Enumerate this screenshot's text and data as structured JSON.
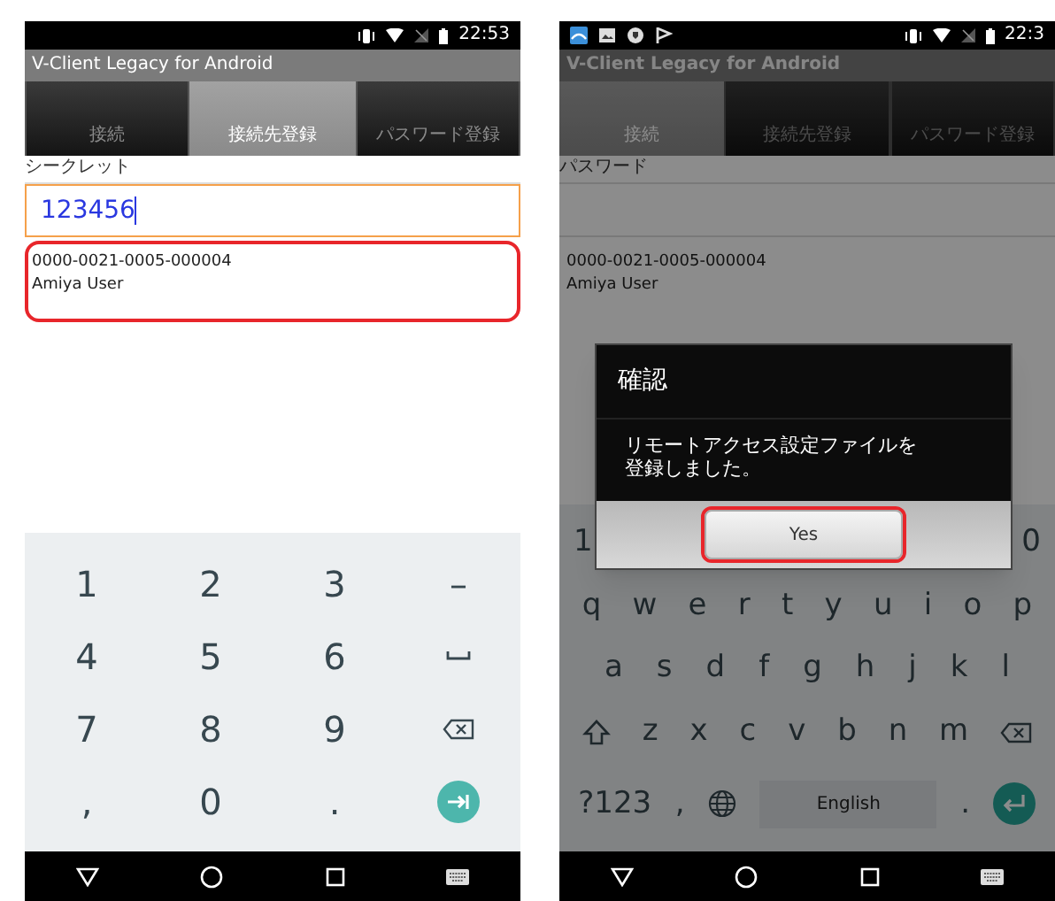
{
  "phones": [
    {
      "status_bar": {
        "has_notifications": false,
        "time": "22:53"
      },
      "app_title": "V-Client Legacy for Android",
      "tabs": [
        {
          "label": "接続",
          "selected": false
        },
        {
          "label": "接続先登録",
          "selected": true
        },
        {
          "label": "パスワード登録",
          "selected": false
        }
      ],
      "field": {
        "label": "シークレット",
        "value": "123456",
        "focused": true
      },
      "entry": {
        "lines": [
          "0000-0021-0005-000004",
          "Amiya User"
        ],
        "highlighted": true
      },
      "keyboard": {
        "kind": "numeric",
        "rows": [
          {
            "keys": [
              {
                "kind": "char",
                "label": "1"
              },
              {
                "kind": "char",
                "label": "2"
              },
              {
                "kind": "char",
                "label": "3"
              },
              {
                "kind": "char",
                "label": "–"
              }
            ]
          },
          {
            "keys": [
              {
                "kind": "char",
                "label": "4"
              },
              {
                "kind": "char",
                "label": "5"
              },
              {
                "kind": "char",
                "label": "6"
              },
              {
                "kind": "space"
              }
            ]
          },
          {
            "keys": [
              {
                "kind": "char",
                "label": "7"
              },
              {
                "kind": "char",
                "label": "8"
              },
              {
                "kind": "char",
                "label": "9"
              },
              {
                "kind": "backspace"
              }
            ]
          },
          {
            "keys": [
              {
                "kind": "char",
                "label": ","
              },
              {
                "kind": "char",
                "label": "0"
              },
              {
                "kind": "char",
                "label": "."
              },
              {
                "kind": "next"
              }
            ]
          }
        ]
      }
    },
    {
      "status_bar": {
        "has_notifications": true,
        "time": "22:3"
      },
      "app_title": "V-Client Legacy for Android",
      "tabs": [
        {
          "label": "接続",
          "selected": true
        },
        {
          "label": "接続先登録",
          "selected": false
        },
        {
          "label": "パスワード登録",
          "selected": false
        }
      ],
      "field": {
        "label": "パスワード",
        "focused": false
      },
      "entry": {
        "lines": [
          "0000-0021-0005-000004",
          "Amiya User"
        ],
        "highlighted": false
      },
      "keyboard": {
        "kind": "qwerty",
        "rows": [
          {
            "keys": [
              {
                "kind": "char",
                "label": "1"
              },
              {
                "kind": "char",
                "label": "0"
              }
            ]
          },
          {
            "keys": [
              {
                "kind": "char",
                "label": "q"
              },
              {
                "kind": "char",
                "label": "w"
              },
              {
                "kind": "char",
                "label": "e"
              },
              {
                "kind": "char",
                "label": "r"
              },
              {
                "kind": "char",
                "label": "t"
              },
              {
                "kind": "char",
                "label": "y"
              },
              {
                "kind": "char",
                "label": "u"
              },
              {
                "kind": "char",
                "label": "i"
              },
              {
                "kind": "char",
                "label": "o"
              },
              {
                "kind": "char",
                "label": "p"
              }
            ]
          },
          {
            "keys": [
              {
                "kind": "char",
                "label": "a"
              },
              {
                "kind": "char",
                "label": "s"
              },
              {
                "kind": "char",
                "label": "d"
              },
              {
                "kind": "char",
                "label": "f"
              },
              {
                "kind": "char",
                "label": "g"
              },
              {
                "kind": "char",
                "label": "h"
              },
              {
                "kind": "char",
                "label": "j"
              },
              {
                "kind": "char",
                "label": "k"
              },
              {
                "kind": "char",
                "label": "l"
              }
            ]
          },
          {
            "keys": [
              {
                "kind": "shift"
              },
              {
                "kind": "char",
                "label": "z"
              },
              {
                "kind": "char",
                "label": "x"
              },
              {
                "kind": "char",
                "label": "c"
              },
              {
                "kind": "char",
                "label": "v"
              },
              {
                "kind": "char",
                "label": "b"
              },
              {
                "kind": "char",
                "label": "n"
              },
              {
                "kind": "char",
                "label": "m"
              },
              {
                "kind": "backspace"
              }
            ]
          },
          {
            "keys": [
              {
                "kind": "char",
                "label": "?123"
              },
              {
                "kind": "char",
                "label": ","
              },
              {
                "kind": "globe"
              },
              {
                "kind": "spacebar",
                "label": "English"
              },
              {
                "kind": "char",
                "label": "."
              },
              {
                "kind": "enter"
              }
            ]
          }
        ]
      },
      "dialog": {
        "title": "確認",
        "message": "リモートアクセス設定ファイルを登録しました。",
        "button": {
          "label": "Yes",
          "highlighted": true
        }
      }
    }
  ]
}
